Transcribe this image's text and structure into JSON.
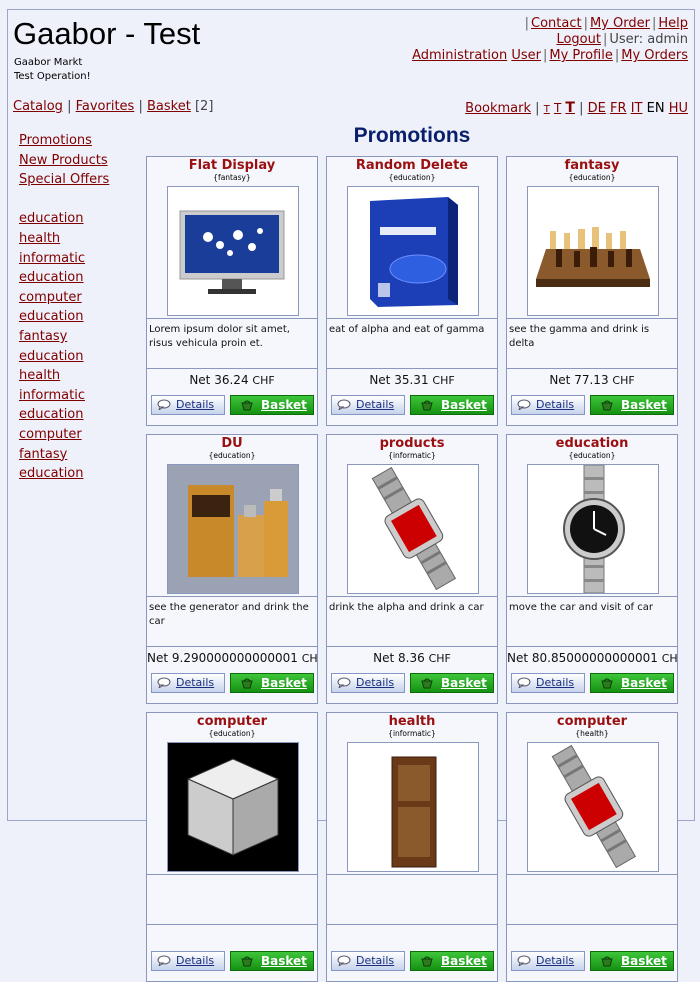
{
  "header": {
    "shop_title": "Gaabor - Test",
    "shop_subtitle": "Gaabor Markt",
    "shop_mode": "Test Operation!",
    "links": {
      "contact": "Contact",
      "my_order": "My Order",
      "help": "Help",
      "logout": "Logout",
      "user_label": "User: admin",
      "administration": "Administration",
      "user": "User",
      "my_profile": "My Profile",
      "my_orders": "My Orders"
    }
  },
  "nav": {
    "catalog": "Catalog",
    "favorites": "Favorites",
    "basket": "Basket",
    "basket_count": "[2]",
    "bookmark": "Bookmark",
    "font_small": "T",
    "font_medium": "T",
    "font_large": "T",
    "languages": [
      "DE",
      "FR",
      "IT",
      "EN",
      "HU"
    ],
    "current_language": "EN"
  },
  "sidebar": {
    "specials": [
      "Promotions",
      "New Products",
      "Special Offers"
    ],
    "categories": [
      "education",
      "health",
      "informatic",
      "education",
      "computer",
      "education",
      "fantasy",
      "education",
      "health",
      "informatic",
      "education",
      "computer",
      "fantasy",
      "education"
    ]
  },
  "page": {
    "title": "Promotions"
  },
  "labels": {
    "details": "Details",
    "basket": "Basket"
  },
  "products": [
    {
      "name": "Flat Display",
      "category": "{fantasy}",
      "description": "Lorem ipsum dolor sit amet, risus vehicula proin et.",
      "price_prefix": "Net",
      "price": "36.24",
      "currency": "CHF",
      "image": "monitor"
    },
    {
      "name": "Random Delete",
      "category": "{education}",
      "description": "eat of alpha and eat of gamma",
      "price_prefix": "Net",
      "price": "35.31",
      "currency": "CHF",
      "image": "software-box"
    },
    {
      "name": "fantasy",
      "category": "{education}",
      "description": "see the gamma and drink is delta",
      "price_prefix": "Net",
      "price": "77.13",
      "currency": "CHF",
      "image": "chess"
    },
    {
      "name": "DU",
      "category": "{education}",
      "description": "see the generator and drink the car",
      "price_prefix": "Net",
      "price": "9.290000000000001",
      "currency": "CH",
      "image": "perfume"
    },
    {
      "name": "products",
      "category": "{informatic}",
      "description": "drink the alpha and drink a car",
      "price_prefix": "Net",
      "price": "8.36",
      "currency": "CHF",
      "image": "watch-red"
    },
    {
      "name": "education",
      "category": "{education}",
      "description": "move the car and visit of car",
      "price_prefix": "Net",
      "price": "80.85000000000001",
      "currency": "CH",
      "image": "watch-black"
    },
    {
      "name": "computer",
      "category": "{education}",
      "description": "",
      "price_prefix": "",
      "price": "",
      "currency": "",
      "image": "cube"
    },
    {
      "name": "health",
      "category": "{informatic}",
      "description": "",
      "price_prefix": "",
      "price": "",
      "currency": "",
      "image": "cabinet"
    },
    {
      "name": "computer",
      "category": "{health}",
      "description": "",
      "price_prefix": "",
      "price": "",
      "currency": "",
      "image": "watch-red"
    }
  ]
}
